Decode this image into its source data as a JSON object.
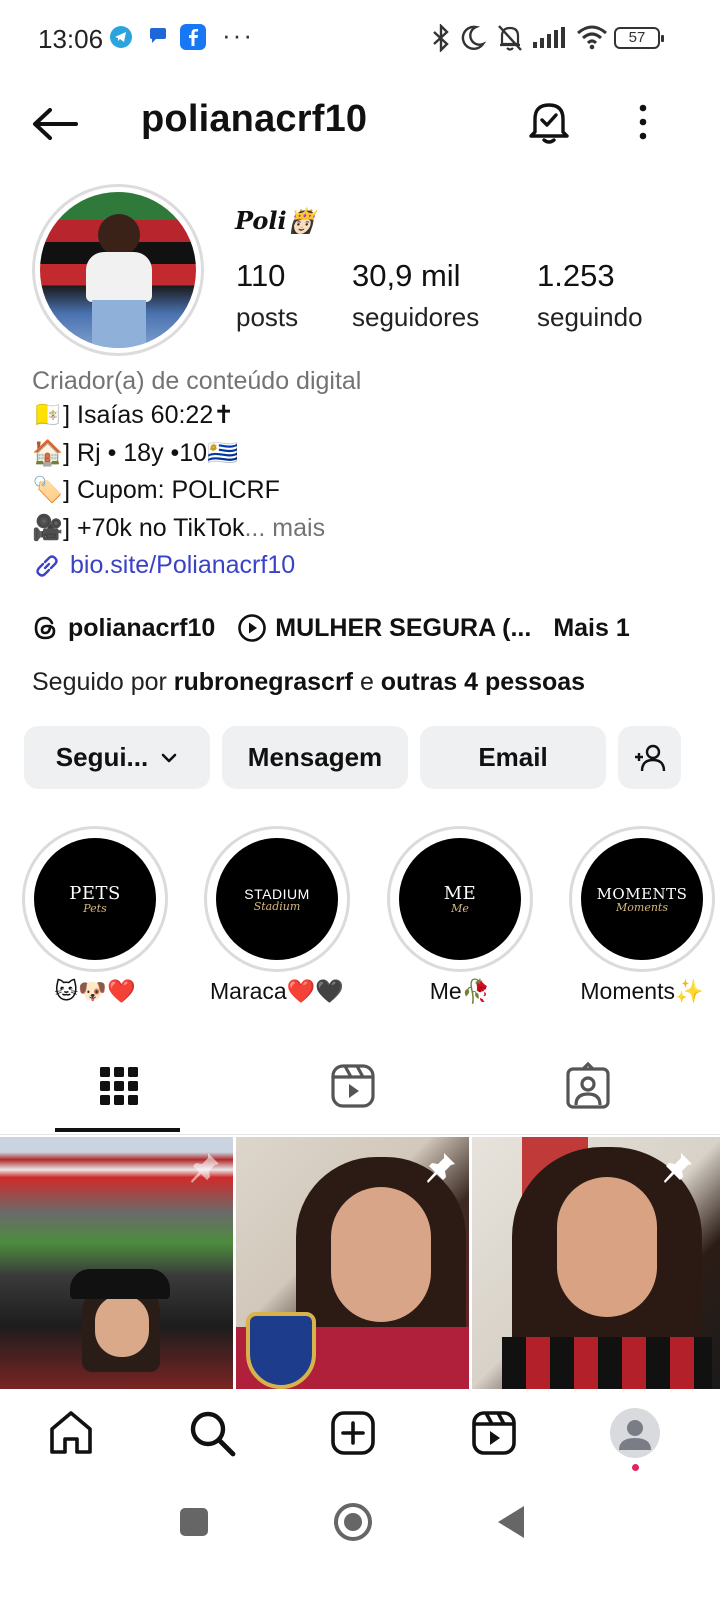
{
  "status_bar": {
    "time": "13:06",
    "more": "···",
    "battery": "57"
  },
  "header": {
    "username": "polianacrf10"
  },
  "profile": {
    "display_name": "Poli👸🏻",
    "stats": [
      {
        "value": "110",
        "label": "posts"
      },
      {
        "value": "30,9 mil",
        "label": "seguidores"
      },
      {
        "value": "1.253",
        "label": "seguindo"
      }
    ]
  },
  "bio": {
    "category": "Criador(a) de conteúdo digital",
    "lines": [
      "🇻🇦] Isaías 60:22✝",
      "🏠] Rj • 18y •10🇺🇾",
      "🏷️] Cupom: POLICRF",
      "🎥] +70k no TikTok"
    ],
    "more_ellipsis": "... ",
    "more_label": "mais",
    "link": "bio.site/Polianacrf10"
  },
  "chips": {
    "threads": "polianacrf10",
    "video": "MULHER SEGURA (...",
    "more": "Mais 1"
  },
  "followed_by": {
    "prefix": "Seguido por ",
    "user": "rubronegrascrf",
    "middle": " e ",
    "others": "outras 4 pessoas"
  },
  "buttons": {
    "follow": "Segui...",
    "message": "Mensagem",
    "email": "Email"
  },
  "highlights": [
    {
      "cover": "PETS",
      "sub": "Pets",
      "caption": "🐱🐶❤️"
    },
    {
      "cover": "STADIUM",
      "sub": "Stadium",
      "caption": "Maraca❤️🖤"
    },
    {
      "cover": "ME",
      "sub": "Me",
      "caption": "Me🥀"
    },
    {
      "cover": "MOMENTS",
      "sub": "Moments",
      "caption": "Moments✨"
    }
  ],
  "colors": {
    "link": "#3a42c8",
    "button_bg": "#eff0f2",
    "muted": "#737373",
    "notification_dot": "#e0245e"
  },
  "icons": {
    "header": [
      "back-arrow-icon",
      "bell-check-icon",
      "more-vertical-icon"
    ],
    "tabs": [
      "grid-icon",
      "reels-icon",
      "tagged-icon"
    ],
    "nav": [
      "home-icon",
      "search-icon",
      "create-icon",
      "reels-icon",
      "profile-icon"
    ]
  }
}
